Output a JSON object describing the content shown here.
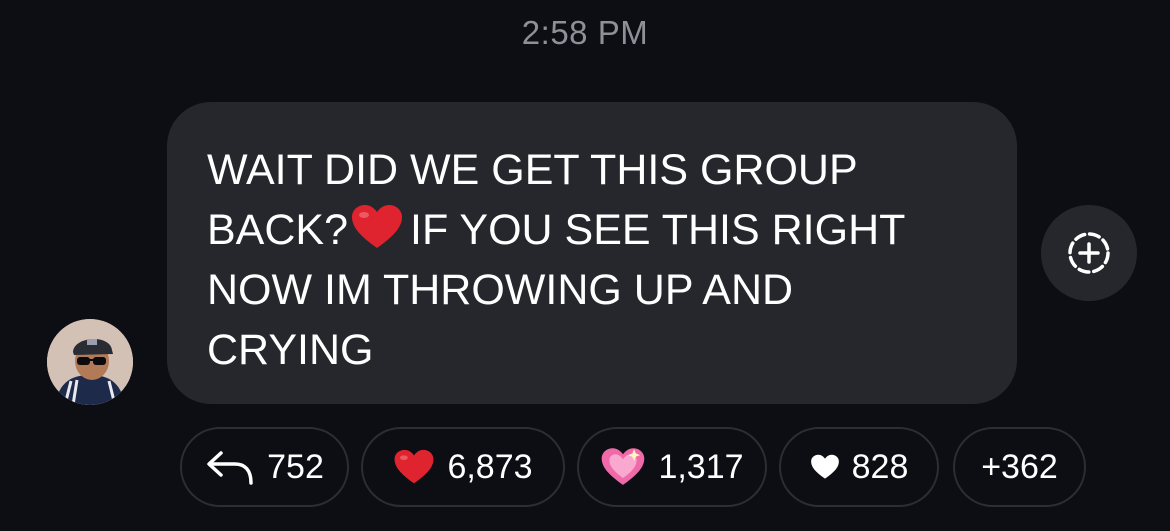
{
  "header": {
    "timestamp": "2:58 PM"
  },
  "message": {
    "text_before_emoji": "WAIT DID WE GET THIS GROUP\nBACK?",
    "emoji": "red-heart",
    "text_after_emoji": "IF YOU SEE THIS RIGHT\nNOW IM THROWING UP AND\nCRYING"
  },
  "reactions": [
    {
      "icon": "reply-arrow-icon",
      "count": "752"
    },
    {
      "icon": "red-heart-icon",
      "count": "6,873"
    },
    {
      "icon": "sparkling-heart-icon",
      "count": "1,317"
    },
    {
      "icon": "white-heart-icon",
      "count": "828"
    },
    {
      "icon": "",
      "count": "+362"
    }
  ],
  "colors": {
    "background": "#0c0e13",
    "bubble": "#26272c",
    "timestamp": "#8d9098",
    "pill_border": "#2c2e34",
    "heart_red": "#e0242f",
    "heart_pink": "#f06aa9"
  }
}
